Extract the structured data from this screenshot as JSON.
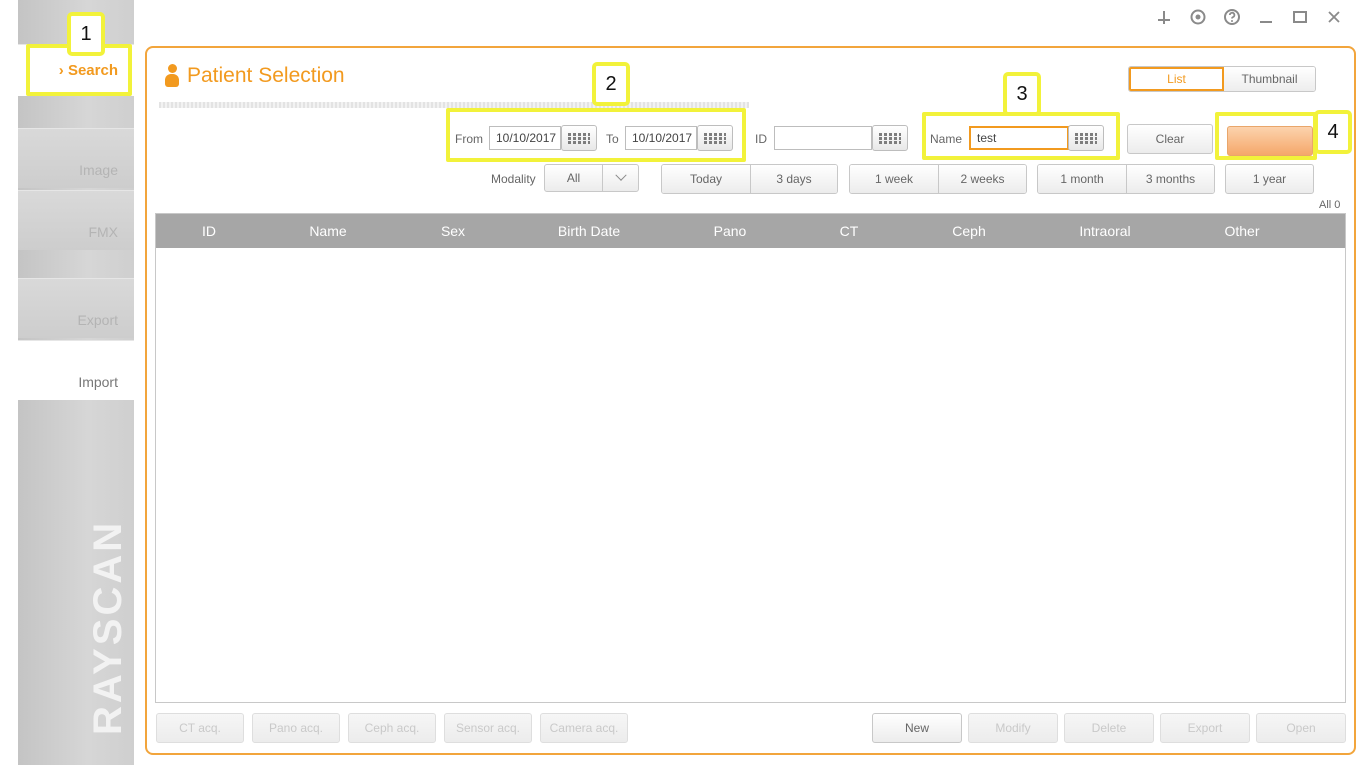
{
  "sidebar": {
    "items": [
      {
        "label": "› Search"
      },
      {
        "label": "Image"
      },
      {
        "label": "FMX"
      },
      {
        "label": "Export"
      },
      {
        "label": "Import"
      }
    ],
    "brand": "RAYSCAN"
  },
  "window_controls": [
    "pin-icon",
    "settings-icon",
    "help-icon",
    "minimize-icon",
    "maximize-icon",
    "close-icon"
  ],
  "page": {
    "title": "Patient Selection"
  },
  "view_toggle": {
    "list": "List",
    "thumbnail": "Thumbnail"
  },
  "search": {
    "from_label": "From",
    "from_value": "10/10/2017",
    "to_label": "To",
    "to_value": "10/10/2017",
    "id_label": "ID",
    "id_value": "",
    "name_label": "Name",
    "name_value": "test",
    "clear_label": "Clear",
    "search_label": ""
  },
  "filters": {
    "modality_label": "Modality",
    "modality_value": "All",
    "range_buttons": [
      "Today",
      "3 days",
      "1 week",
      "2 weeks",
      "1 month",
      "3 months",
      "1 year"
    ]
  },
  "result_count": "All 0",
  "table": {
    "columns": [
      "ID",
      "Name",
      "Sex",
      "Birth Date",
      "Pano",
      "CT",
      "Ceph",
      "Intraoral",
      "Other"
    ],
    "rows": []
  },
  "footer": {
    "left_buttons": [
      "CT acq.",
      "Pano acq.",
      "Ceph acq.",
      "Sensor acq.",
      "Camera acq."
    ],
    "right_buttons": [
      "New",
      "Modify",
      "Delete",
      "Export",
      "Open"
    ]
  },
  "annotations": [
    "1",
    "2",
    "3",
    "4"
  ],
  "colors": {
    "accent": "#f29a1f",
    "highlight": "#f2f23a",
    "header": "#a6a6a6"
  }
}
